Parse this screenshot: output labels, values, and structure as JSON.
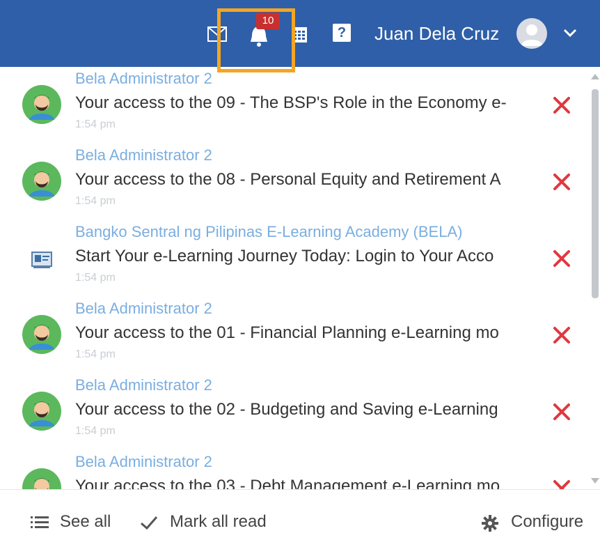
{
  "header": {
    "notification_count": "10",
    "user_name": "Juan Dela Cruz",
    "help_glyph": "?"
  },
  "notifications": [
    {
      "sender": "Bela Administrator 2",
      "message": "Your access to the 09 - The BSP's Role in the Economy e-",
      "time": "1:54 pm",
      "avatar": "user-avatar-icon"
    },
    {
      "sender": "Bela Administrator 2",
      "message": "Your access to the 08 - Personal Equity and Retirement A",
      "time": "1:54 pm",
      "avatar": "user-avatar-icon"
    },
    {
      "sender": "Bangko Sentral ng Pilipinas E-Learning Academy (BELA)",
      "message": "Start Your e-Learning Journey Today: Login to Your Acco",
      "time": "1:54 pm",
      "avatar": "academy-logo-icon"
    },
    {
      "sender": "Bela Administrator 2",
      "message": "Your access to the 01 - Financial Planning e-Learning mo",
      "time": "1:54 pm",
      "avatar": "user-avatar-icon"
    },
    {
      "sender": "Bela Administrator 2",
      "message": "Your access to the 02 - Budgeting and Saving e-Learning",
      "time": "1:54 pm",
      "avatar": "user-avatar-icon"
    },
    {
      "sender": "Bela Administrator 2",
      "message": "Your access to the 03 - Debt Management e-Learning mo",
      "time": "",
      "avatar": "user-avatar-icon"
    }
  ],
  "footer": {
    "see_all": "See all",
    "mark_all_read": "Mark all read",
    "configure": "Configure"
  },
  "colors": {
    "header_bg": "#2f5fa8",
    "sender_text": "#7aaee0",
    "dismiss_x": "#e0383e",
    "badge": "#c8302f",
    "highlight": "#f4a623"
  }
}
